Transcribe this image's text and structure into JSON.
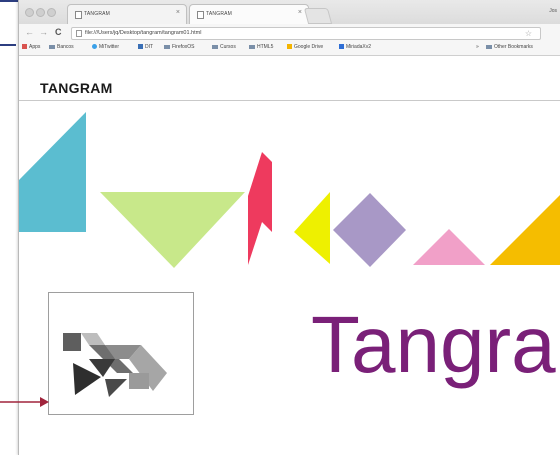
{
  "browser": {
    "tabs": [
      {
        "title": "TANGRAM",
        "close": "×"
      },
      {
        "title": "TANGRAM",
        "close": "×"
      }
    ],
    "user": "Jos",
    "nav": {
      "back": "←",
      "forward": "→",
      "reload": "C"
    },
    "address": "file:///Users/jq/Desktop/tangram/tangram01.html",
    "bookmark_star": "☆",
    "bookmarks": [
      "Apps",
      "Bancos",
      "MiTwitter",
      "DIT",
      "FirefoxOS",
      "Cursos",
      "HTML5",
      "Google Drive",
      "MiriadaXv2"
    ],
    "bookmarks_more": "»",
    "other_bookmarks": "Other Bookmarks"
  },
  "page": {
    "header_title": "TANGRAM",
    "big_title": "Tangram"
  },
  "colors": {
    "teal_triangle": "#5bbdd0",
    "green_triangle": "#c8e88a",
    "red_parallelogram": "#ee3a5e",
    "yellow_triangle": "#eef000",
    "purple_square": "#a898c6",
    "pink_triangle": "#f1a0c8",
    "orange_triangle": "#f5bd00",
    "title_purple": "#7a2078",
    "arrow": "#a0243c",
    "slide_rule": "#2c3e80"
  },
  "icons": [
    "back-arrow-icon",
    "forward-arrow-icon",
    "reload-icon",
    "page-icon",
    "star-icon",
    "folder-icon",
    "twitter-icon",
    "tangram-figure-icon"
  ]
}
